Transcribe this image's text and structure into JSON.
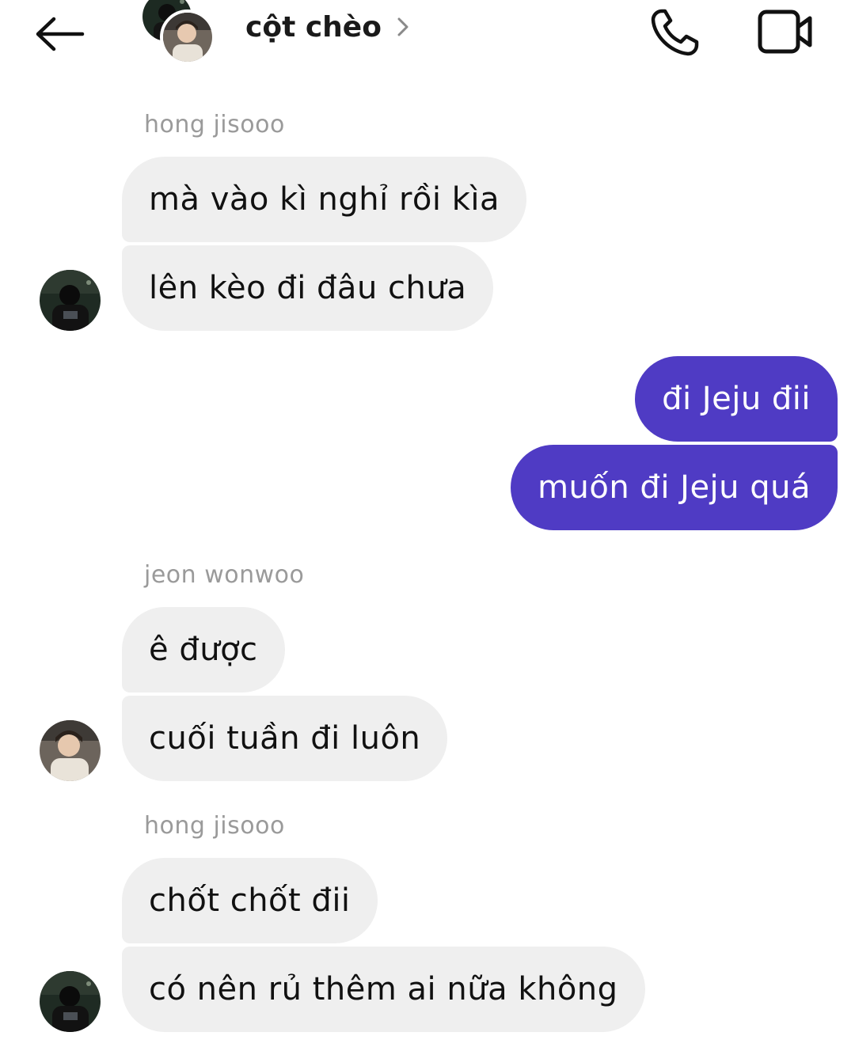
{
  "header": {
    "title": "cột chèo",
    "back_icon": "arrow-left-icon",
    "chevron_icon": "chevron-right-icon",
    "call_icon": "phone-icon",
    "video_icon": "video-camera-icon"
  },
  "messages": {
    "group1": {
      "sender": "hong jisooo",
      "bubble1": "mà vào kì nghỉ rồi kìa",
      "bubble2": "lên kèo đi đâu chưa"
    },
    "group2": {
      "bubble1": "đi Jeju đii",
      "bubble2": "muốn đi Jeju quá"
    },
    "group3": {
      "sender": "jeon wonwoo",
      "bubble1": "ê được",
      "bubble2": "cuối tuần đi luôn"
    },
    "group4": {
      "sender": "hong jisooo",
      "bubble1": "chốt chốt đii",
      "bubble2": "có nên rủ thêm ai nữa không"
    }
  },
  "colors": {
    "incoming_bubble": "#efefef",
    "outgoing_bubble": "#4f3bc4",
    "sender_name": "#9a9a9a"
  }
}
